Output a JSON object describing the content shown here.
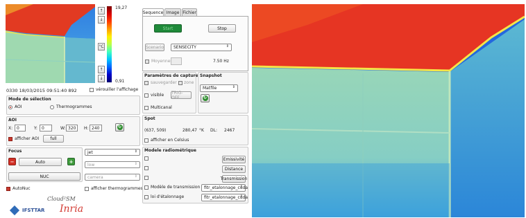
{
  "thermal": {
    "scale_max": "19,27",
    "scale_min": "0,91",
    "scale_unit": "°C",
    "timestamp": "0330 18/03/2015 09:51:40 892",
    "lock_label": "vérouiller l'affichage"
  },
  "selection": {
    "title": "Mode de sélection",
    "aoi_label": "AOI",
    "thermo_label": "Thermogrammes"
  },
  "aoi": {
    "title": "AOI",
    "x_label": "X:",
    "x": "0",
    "y_label": "Y:",
    "y": "0",
    "w_label": "W:",
    "w": "320",
    "h_label": "H:",
    "h": "240",
    "show_label": "afficher AOI",
    "full_label": "full"
  },
  "focus": {
    "title": "Focus",
    "minus": "−",
    "auto_label": "Auto",
    "plus": "+",
    "nuc_label": "NUC",
    "palette": "jet",
    "low_opt": "low",
    "camera_opt": "camera"
  },
  "bottom": {
    "autonuc_label": "AutoNuc",
    "show_thermo_label": "afficher thermogrammes"
  },
  "logos": {
    "ifsttar": "IFSTTAR",
    "inria": "Inria",
    "brand": "Cloud²SM"
  },
  "tabs": [
    "Sequence",
    "Image",
    "Fichier"
  ],
  "sequence": {
    "start_label": "Start",
    "stop_label": "Stop",
    "scenario_label": "Scenario",
    "scenario_value": "SENSECITY",
    "moyenner_label": "Moyenner",
    "rate": "7.50 Hz"
  },
  "capture": {
    "title": "Paramètres de capture",
    "sauvegarder": "sauvegarder",
    "zone": "zone",
    "visible": "visible",
    "trig_label": "TRIG-OFF",
    "multicanal": "Multicanal"
  },
  "snapshot": {
    "title": "Snapshot",
    "value": "Matfile"
  },
  "spot": {
    "title": "Spot",
    "coords": "(637, 509)",
    "temp": "280,47",
    "unit": "°K",
    "dl_label": "DL:",
    "dl": "2467",
    "celsius_label": "afficher en Celsius"
  },
  "radio": {
    "title": "Modele radiométrique",
    "emissivite": "Emissivité",
    "distance": "Distance",
    "transmission": "Transmission",
    "trans_model_label": "Modèle de transmission",
    "trans_model_value": "fitr_etalonnage_cuda",
    "calib_label": "loi d'étalonnage",
    "calib_value": "fitr_etalonnage_cuda"
  }
}
